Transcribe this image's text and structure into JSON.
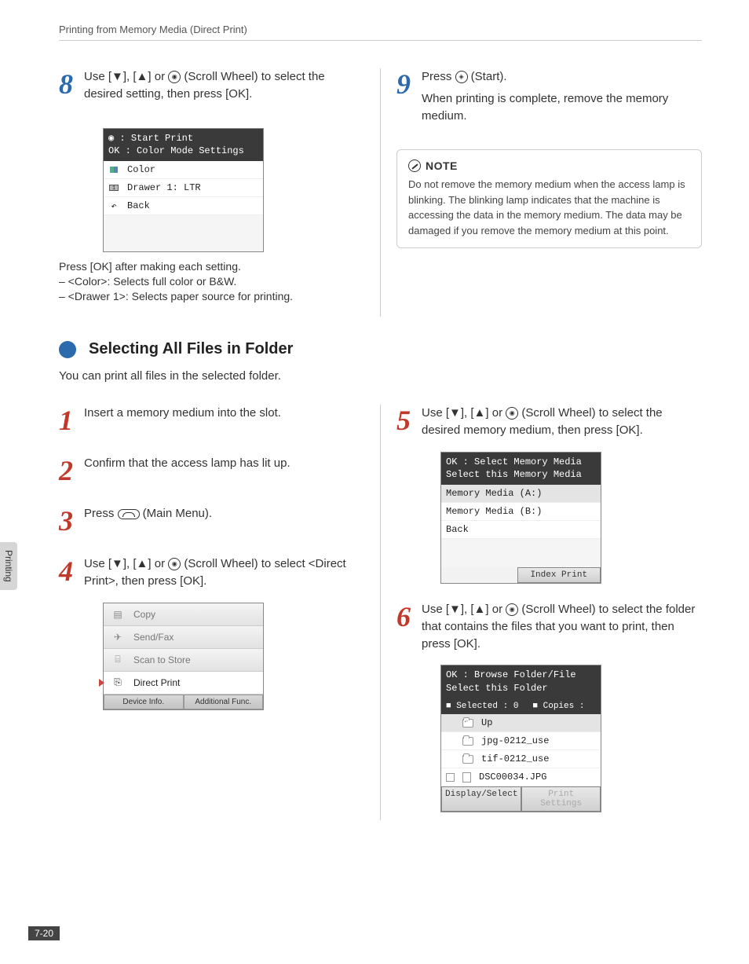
{
  "breadcrumb": "Printing from Memory Media (Direct Print)",
  "side_tab": "Printing",
  "page_number": "7-20",
  "step8": {
    "num": "8",
    "text_a": "Use [",
    "text_b": "], [",
    "text_c": "] or ",
    "text_d": " (Scroll Wheel) to select the desired setting, then press [OK].",
    "lcd_hdr1": "◉ : Start Print",
    "lcd_hdr2": "OK : Color Mode Settings",
    "row1": "Color",
    "row2": "Drawer 1: LTR",
    "row3": "Back",
    "after1": "Press [OK] after making each setting.",
    "after2": "– <Color>: Selects full color or B&W.",
    "after3": "– <Drawer 1>: Selects paper source for printing."
  },
  "step9": {
    "num": "9",
    "text_a": "Press ",
    "text_b": " (Start).",
    "text_c": "When printing is complete, remove the memory medium.",
    "note_hdr": "NOTE",
    "note_body": "Do not remove the memory medium when the access lamp is blinking. The blinking lamp indicates that the machine is accessing the data in the memory medium. The data may be damaged if you remove the memory medium at this point."
  },
  "section": {
    "title": "Selecting All Files in Folder",
    "sub": "You can print all files in the selected folder."
  },
  "s1": {
    "num": "1",
    "text": "Insert a memory medium into the slot."
  },
  "s2": {
    "num": "2",
    "text": "Confirm that the access lamp has lit up."
  },
  "s3": {
    "num": "3",
    "text_a": "Press ",
    "text_b": " (Main Menu)."
  },
  "s4": {
    "num": "4",
    "text_a": "Use [",
    "text_b": "], [",
    "text_c": "] or ",
    "text_d": " (Scroll Wheel) to select <Direct Print>, then press [OK].",
    "menu": {
      "m1": "Copy",
      "m2": "Send/Fax",
      "m3": "Scan to Store",
      "m4": "Direct Print",
      "f1": "Device Info.",
      "f2": "Additional Func."
    }
  },
  "s5": {
    "num": "5",
    "text_a": "Use [",
    "text_b": "], [",
    "text_c": "] or ",
    "text_d": " (Scroll Wheel) to select the desired memory medium, then press [OK].",
    "lcd_hdr1": "OK : Select Memory Media",
    "lcd_hdr2": "Select this Memory Media",
    "r1": "Memory Media (A:)",
    "r2": "Memory Media (B:)",
    "r3": "Back",
    "footer": "Index Print"
  },
  "s6": {
    "num": "6",
    "text_a": "Use [",
    "text_b": "], [",
    "text_c": "] or ",
    "text_d": " (Scroll Wheel) to select the folder that contains the files that you want to print, then press [OK].",
    "lcd_hdr1": "OK : Browse Folder/File",
    "lcd_hdr2": "Select this Folder",
    "status_a": "■ Selected : 0",
    "status_b": "■ Copies   :",
    "r1": "Up",
    "r2": "jpg-0212_use",
    "r3": "tif-0212_use",
    "r4": "DSC00034.JPG",
    "f1": "Display/Select",
    "f2": "Print Settings"
  }
}
